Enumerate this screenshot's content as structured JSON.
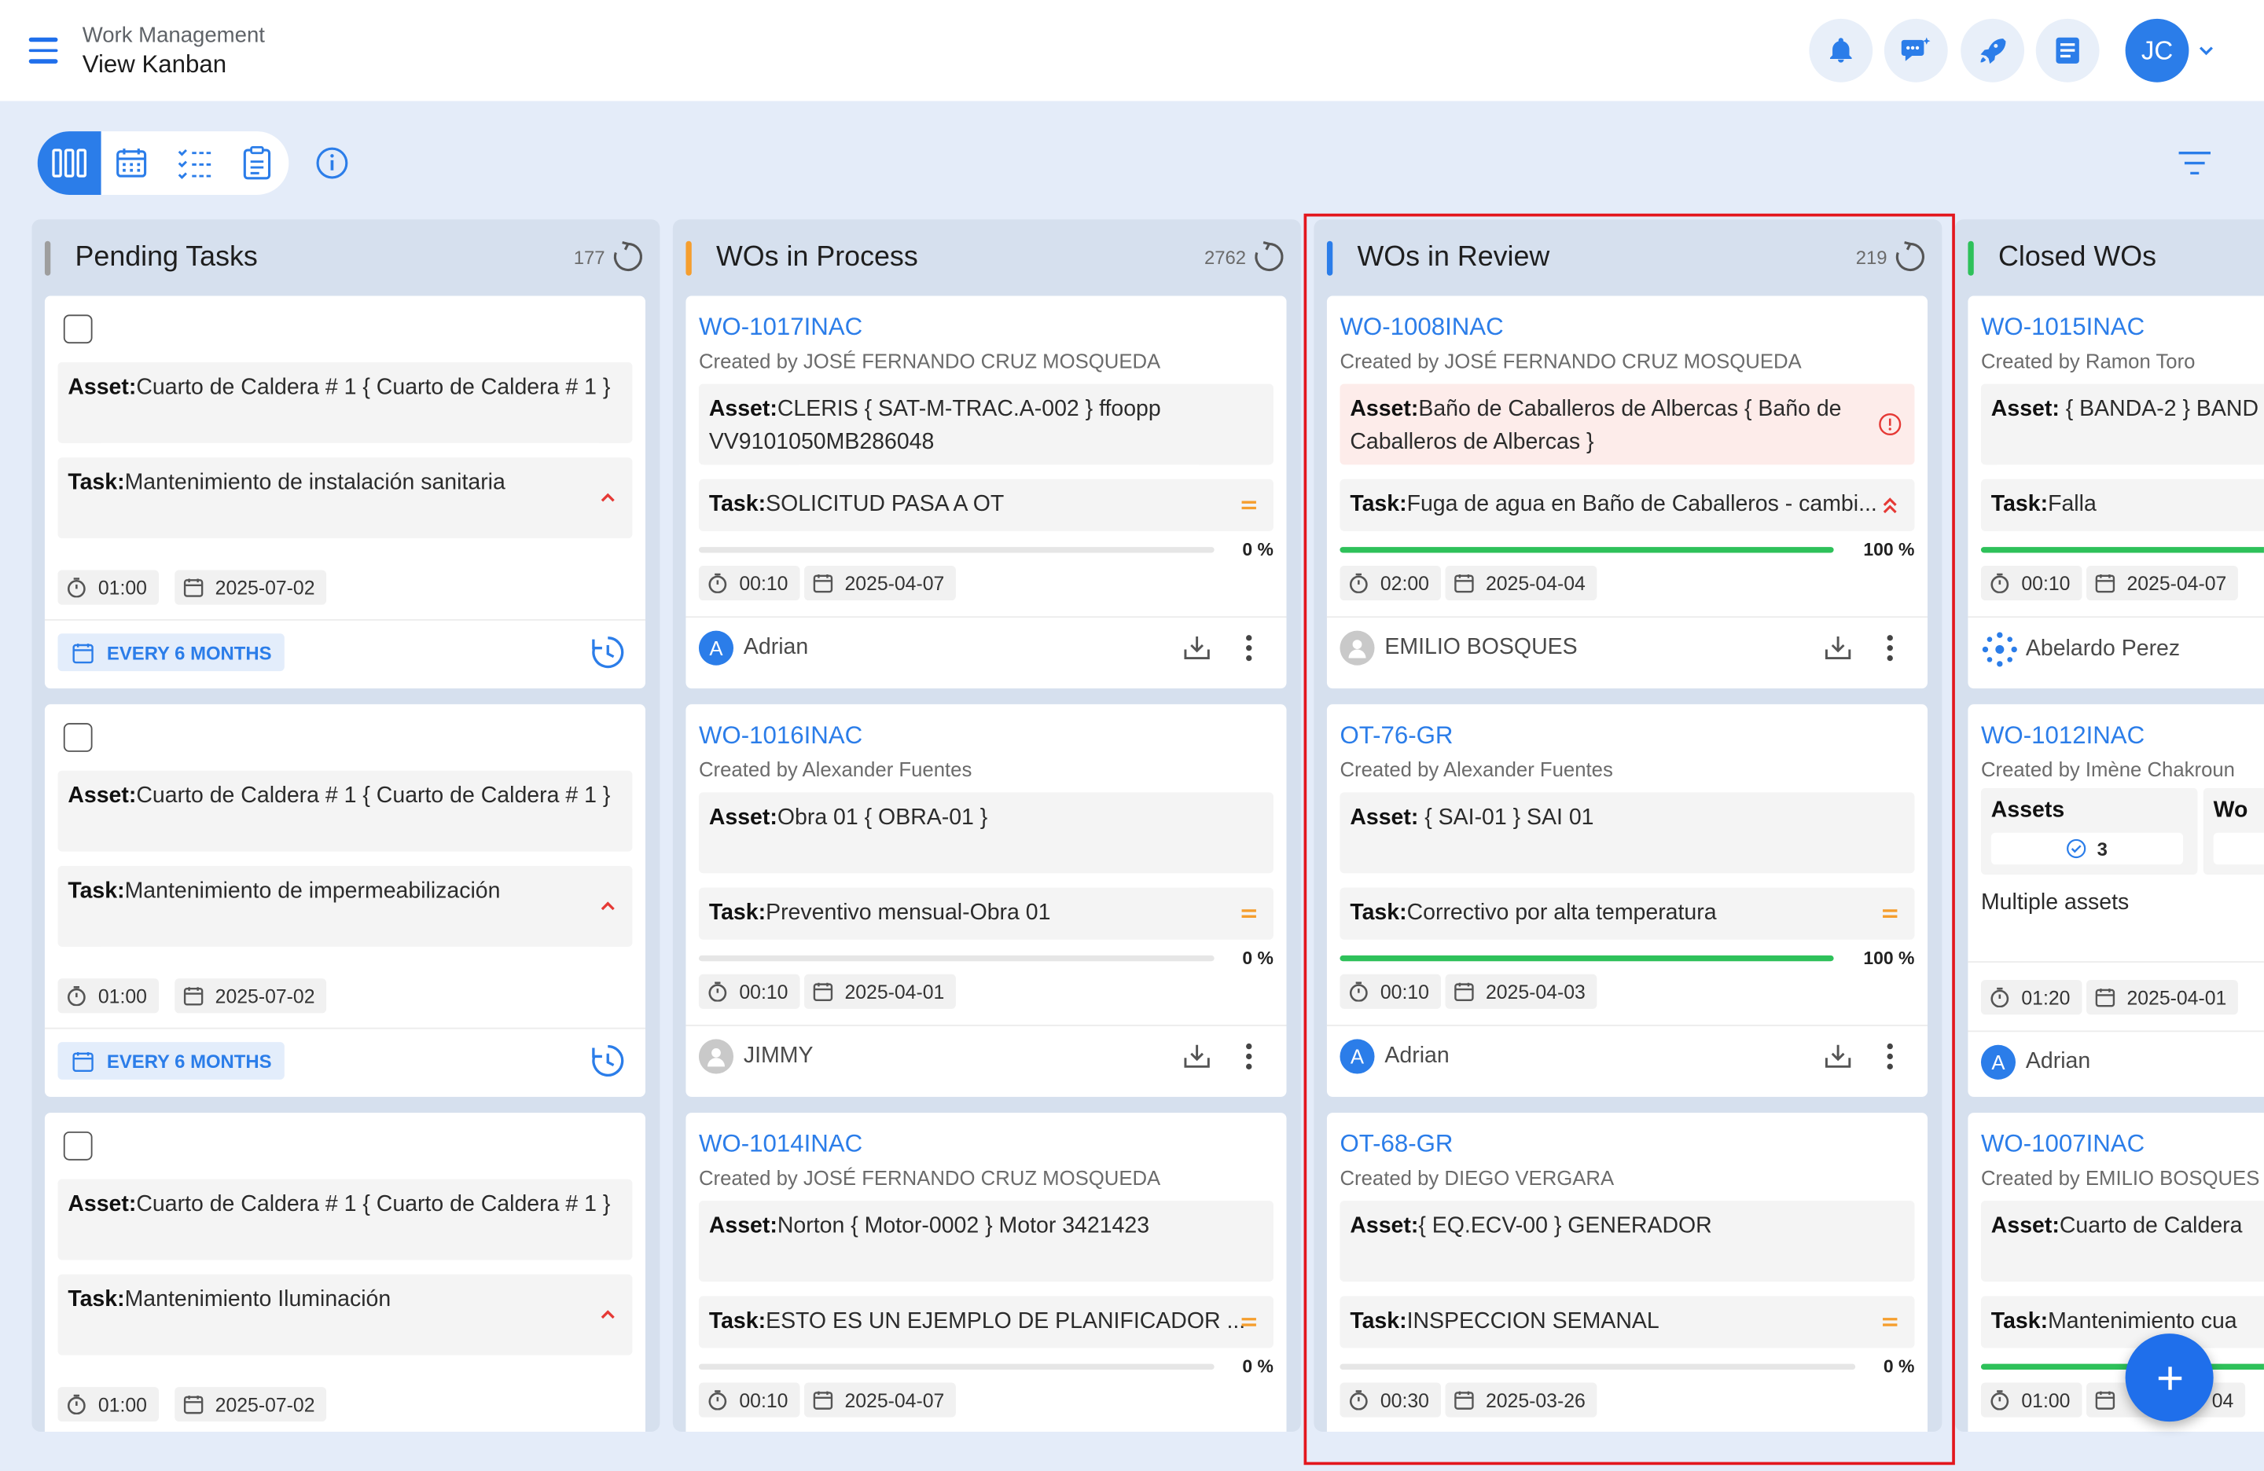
{
  "header": {
    "subtitle": "Work Management",
    "title": "View Kanban",
    "avatar_initials": "JC"
  },
  "columns": [
    {
      "title": "Pending Tasks",
      "count": "177",
      "accent": "#9e9e9e",
      "cards": [
        {
          "asset_label": "Asset:",
          "asset": "Cuarto de Caldera # 1 { Cuarto de Caldera # 1 }",
          "task_label": "Task:",
          "task": "Mantenimiento de instalación sanitaria",
          "time": "01:00",
          "date": "2025-07-02",
          "frequency": "EVERY 6 MONTHS"
        },
        {
          "asset_label": "Asset:",
          "asset": "Cuarto de Caldera # 1 { Cuarto de Caldera # 1 }",
          "task_label": "Task:",
          "task": "Mantenimiento de impermeabilización",
          "time": "01:00",
          "date": "2025-07-02",
          "frequency": "EVERY 6 MONTHS"
        },
        {
          "asset_label": "Asset:",
          "asset": "Cuarto de Caldera # 1 { Cuarto de Caldera # 1 }",
          "task_label": "Task:",
          "task": "Mantenimiento Iluminación",
          "time": "01:00",
          "date": "2025-07-02"
        }
      ]
    },
    {
      "title": "WOs in Process",
      "count": "2762",
      "accent": "#f59e2e",
      "cards": [
        {
          "id": "WO-1017INAC",
          "created": "Created by JOSÉ FERNANDO CRUZ MOSQUEDA",
          "asset_label": "Asset:",
          "asset": "CLERIS { SAT-M-TRAC.A-002 } ffoopp VV9101050MB286048",
          "task_label": "Task:",
          "task": "SOLICITUD PASA A OT",
          "progress": "0 %",
          "time": "00:10",
          "date": "2025-04-07",
          "assignee": "Adrian",
          "assignee_initial": "A"
        },
        {
          "id": "WO-1016INAC",
          "created": "Created by Alexander Fuentes",
          "asset_label": "Asset:",
          "asset": "Obra 01 { OBRA-01 }",
          "task_label": "Task:",
          "task": "Preventivo mensual-Obra 01",
          "progress": "0 %",
          "time": "00:10",
          "date": "2025-04-01",
          "assignee": "JIMMY"
        },
        {
          "id": "WO-1014INAC",
          "created": "Created by JOSÉ FERNANDO CRUZ MOSQUEDA",
          "asset_label": "Asset:",
          "asset": "Norton { Motor-0002 } Motor 3421423",
          "task_label": "Task:",
          "task": "ESTO ES UN EJEMPLO DE PLANIFICADOR ...",
          "progress": "0 %",
          "time": "00:10",
          "date": "2025-04-07"
        }
      ]
    },
    {
      "title": "WOs in Review",
      "count": "219",
      "accent": "#2b7de9",
      "cards": [
        {
          "id": "WO-1008INAC",
          "created": "Created by JOSÉ FERNANDO CRUZ MOSQUEDA",
          "asset_label": "Asset:",
          "asset": "Baño de Caballeros de Albercas { Baño de Caballeros de Albercas }",
          "task_label": "Task:",
          "task": "Fuga de agua en Baño de Caballeros - cambi...",
          "progress": "100 %",
          "progress_value": 1.0,
          "time": "02:00",
          "date": "2025-04-04",
          "assignee": "EMILIO BOSQUES"
        },
        {
          "id": "OT-76-GR",
          "created": "Created by Alexander Fuentes",
          "asset_label": "Asset:",
          "asset": " { SAI-01 } SAI 01",
          "task_label": "Task:",
          "task": "Correctivo por alta temperatura",
          "progress": "100 %",
          "progress_value": 1.0,
          "time": "00:10",
          "date": "2025-04-03",
          "assignee": "Adrian",
          "assignee_initial": "A"
        },
        {
          "id": "OT-68-GR",
          "created": "Created by DIEGO VERGARA",
          "asset_label": "Asset:",
          "asset": "{ EQ.ECV-00 } GENERADOR",
          "task_label": "Task:",
          "task": "INSPECCION SEMANAL",
          "progress": "0 %",
          "time": "00:30",
          "date": "2025-03-26"
        }
      ]
    },
    {
      "title": "Closed WOs",
      "accent": "#2ec15a",
      "cards": [
        {
          "id": "WO-1015INAC",
          "created": "Created by Ramon Toro",
          "asset_label": "Asset:",
          "asset": " { BANDA-2 } BAND",
          "task_label": "Task:",
          "task": "Falla",
          "time": "00:10",
          "date": "2025-04-07",
          "assignee": "Abelardo Perez"
        },
        {
          "id": "WO-1012INAC",
          "created": "Created by Imène Chakroun",
          "assets_label": "Assets",
          "assets_count": "3",
          "wo_label": "Wo",
          "multiple": "Multiple assets",
          "time": "01:20",
          "date": "2025-04-01",
          "assignee": "Adrian",
          "assignee_initial": "A"
        },
        {
          "id": "WO-1007INAC",
          "created": "Created by EMILIO BOSQUES",
          "asset_label": "Asset:",
          "asset": "Cuarto de Caldera",
          "task_label": "Task:",
          "task": "Mantenimiento cua",
          "time": "01:00",
          "date_partial": "04"
        }
      ]
    }
  ],
  "colors": {
    "primary": "#2b7de9",
    "progress": "#2ec15a",
    "highlight": "#e3171e",
    "priority_high": "#e53935",
    "priority_medium": "#f59e2e"
  },
  "icons": [
    "menu-icon",
    "bell-icon",
    "chat-icon",
    "rocket-icon",
    "book-icon",
    "kanban-icon",
    "calendar-icon",
    "checklist-icon",
    "clipboard-icon",
    "info-icon",
    "filter-icon",
    "refresh-icon",
    "timer-icon",
    "calendar-small-icon",
    "download-icon",
    "more-icon",
    "history-icon",
    "plus-icon"
  ]
}
